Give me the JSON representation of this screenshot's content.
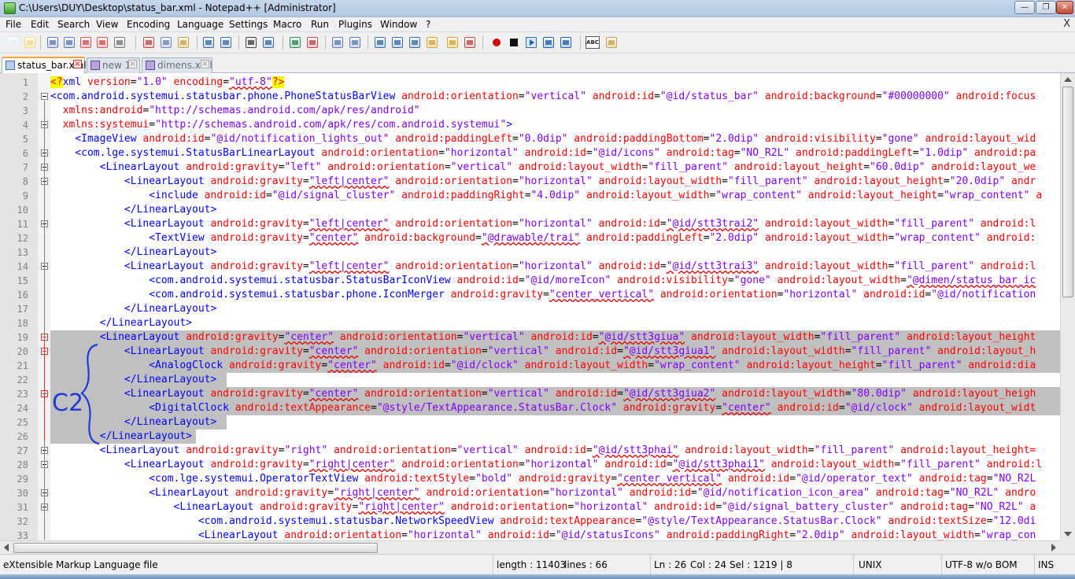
{
  "window": {
    "title": "C:\\Users\\DUY\\Desktop\\status_bar.xml - Notepad++ [Administrator]",
    "minimize": "—",
    "maximize": "❐",
    "close": "✕"
  },
  "menu": [
    "File",
    "Edit",
    "Search",
    "View",
    "Encoding",
    "Language",
    "Settings",
    "Macro",
    "Run",
    "Plugins",
    "Window",
    "?"
  ],
  "menu_close": "X",
  "tabs": [
    {
      "label": "status_bar.xml",
      "active": true
    },
    {
      "label": "new  1",
      "active": false
    },
    {
      "label": "dimens.xml",
      "active": false
    }
  ],
  "toolbar_icons": [
    "new-file-icon",
    "open-file-icon",
    "save-icon",
    "save-all-icon",
    "close-icon",
    "close-all-icon",
    "print-icon",
    "cut-icon",
    "copy-icon",
    "paste-icon",
    "undo-icon",
    "redo-icon",
    "find-icon",
    "replace-icon",
    "zoom-in-icon",
    "zoom-out-icon",
    "sync-v-icon",
    "sync-h-icon",
    "wrap-icon",
    "all-chars-icon",
    "indent-guide-icon",
    "doc-map-icon",
    "folder-icon",
    "func-list-icon",
    "macro-record-icon",
    "macro-stop-icon",
    "macro-play-icon",
    "macro-play-multi-icon",
    "macro-save-icon",
    "spell-check-icon",
    "plugin-icon"
  ],
  "line_numbers": [
    "1",
    "2",
    "3",
    "4",
    "5",
    "6",
    "7",
    "8",
    "9",
    "10",
    "11",
    "12",
    "13",
    "14",
    "15",
    "16",
    "17",
    "18",
    "19",
    "20",
    "21",
    "22",
    "23",
    "24",
    "25",
    "26",
    "27",
    "28",
    "29",
    "30",
    "31",
    "32",
    "33"
  ],
  "code_lines": [
    [
      [
        "q",
        "<?"
      ],
      [
        "t",
        "xml"
      ],
      [
        "a",
        " version"
      ],
      [
        "p",
        "="
      ],
      [
        "v",
        "\"1.0\""
      ],
      [
        "a",
        " encoding"
      ],
      [
        "p",
        "="
      ],
      [
        "v",
        "\"utf-8\""
      ],
      [
        "q",
        "?>"
      ]
    ],
    [
      [
        "t",
        "<com.android.systemui.statusbar.phone.PhoneStatusBarView"
      ],
      [
        "a",
        " android:orientation"
      ],
      [
        "p",
        "="
      ],
      [
        "v",
        "\"vertical\""
      ],
      [
        "a",
        " android:id"
      ],
      [
        "p",
        "="
      ],
      [
        "v",
        "\"@id/status_bar\""
      ],
      [
        "a",
        " android:background"
      ],
      [
        "p",
        "="
      ],
      [
        "v",
        "\"#00000000\""
      ],
      [
        "a",
        " android:focus"
      ]
    ],
    [
      [
        "a",
        "  xmlns:android"
      ],
      [
        "p",
        "="
      ],
      [
        "v",
        "\"http://schemas.android.com/apk/res/android\""
      ]
    ],
    [
      [
        "a",
        "  xmlns:systemui"
      ],
      [
        "p",
        "="
      ],
      [
        "v",
        "\"http://schemas.android.com/apk/res/com.android.systemui\""
      ],
      [
        "t",
        ">"
      ]
    ],
    [
      [
        "t",
        "    <ImageView"
      ],
      [
        "a",
        " android:id"
      ],
      [
        "p",
        "="
      ],
      [
        "v",
        "\"@id/notification_lights_out\""
      ],
      [
        "a",
        " android:paddingLeft"
      ],
      [
        "p",
        "="
      ],
      [
        "v",
        "\"0.0dip\""
      ],
      [
        "a",
        " android:paddingBottom"
      ],
      [
        "p",
        "="
      ],
      [
        "v",
        "\"2.0dip\""
      ],
      [
        "a",
        " android:visibility"
      ],
      [
        "p",
        "="
      ],
      [
        "v",
        "\"gone\""
      ],
      [
        "a",
        " android:layout_wid"
      ]
    ],
    [
      [
        "t",
        "    <com.lge.systemui.StatusBarLinearLayout"
      ],
      [
        "a",
        " android:orientation"
      ],
      [
        "p",
        "="
      ],
      [
        "v",
        "\"horizontal\""
      ],
      [
        "a",
        " android:id"
      ],
      [
        "p",
        "="
      ],
      [
        "v",
        "\"@id/icons\""
      ],
      [
        "a",
        " android:tag"
      ],
      [
        "p",
        "="
      ],
      [
        "v",
        "\"NO_R2L\""
      ],
      [
        "a",
        " android:paddingLeft"
      ],
      [
        "p",
        "="
      ],
      [
        "v",
        "\"1.0dip\""
      ],
      [
        "a",
        " android:pa"
      ]
    ],
    [
      [
        "t",
        "        <LinearLayout"
      ],
      [
        "a",
        " android:gravity"
      ],
      [
        "p",
        "="
      ],
      [
        "v",
        "\"left\""
      ],
      [
        "a",
        " android:orientation"
      ],
      [
        "p",
        "="
      ],
      [
        "v",
        "\"vertical\""
      ],
      [
        "a",
        " android:layout_width"
      ],
      [
        "p",
        "="
      ],
      [
        "v",
        "\"fill_parent\""
      ],
      [
        "a",
        " android:layout_height"
      ],
      [
        "p",
        "="
      ],
      [
        "v",
        "\"60.0dip\""
      ],
      [
        "a",
        " android:layout_we"
      ]
    ],
    [
      [
        "t",
        "            <LinearLayout"
      ],
      [
        "a",
        " android:gravity"
      ],
      [
        "p",
        "="
      ],
      [
        "v",
        "\"left|center\""
      ],
      [
        "a",
        " android:orientation"
      ],
      [
        "p",
        "="
      ],
      [
        "v",
        "\"horizontal\""
      ],
      [
        "a",
        " android:layout_width"
      ],
      [
        "p",
        "="
      ],
      [
        "v",
        "\"fill_parent\""
      ],
      [
        "a",
        " android:layout_height"
      ],
      [
        "p",
        "="
      ],
      [
        "v",
        "\"20.0dip\""
      ],
      [
        "a",
        " andr"
      ]
    ],
    [
      [
        "t",
        "                <include"
      ],
      [
        "a",
        " android:id"
      ],
      [
        "p",
        "="
      ],
      [
        "v",
        "\"@id/signal_cluster\""
      ],
      [
        "a",
        " android:paddingRight"
      ],
      [
        "p",
        "="
      ],
      [
        "v",
        "\"4.0dip\""
      ],
      [
        "a",
        " android:layout_width"
      ],
      [
        "p",
        "="
      ],
      [
        "v",
        "\"wrap_content\""
      ],
      [
        "a",
        " android:layout_height"
      ],
      [
        "p",
        "="
      ],
      [
        "v",
        "\"wrap_content\""
      ],
      [
        "a",
        " a"
      ]
    ],
    [
      [
        "t",
        "            </LinearLayout>"
      ]
    ],
    [
      [
        "t",
        "            <LinearLayout"
      ],
      [
        "a",
        " android:gravity"
      ],
      [
        "p",
        "="
      ],
      [
        "v",
        "\"left|center\""
      ],
      [
        "a",
        " android:orientation"
      ],
      [
        "p",
        "="
      ],
      [
        "v",
        "\"horizontal\""
      ],
      [
        "a",
        " android:id"
      ],
      [
        "p",
        "="
      ],
      [
        "v",
        "\"@id/stt3trai2\""
      ],
      [
        "a",
        " android:layout_width"
      ],
      [
        "p",
        "="
      ],
      [
        "v",
        "\"fill_parent\""
      ],
      [
        "a",
        " android:l"
      ]
    ],
    [
      [
        "t",
        "                <TextView"
      ],
      [
        "a",
        " android:gravity"
      ],
      [
        "p",
        "="
      ],
      [
        "v",
        "\"center\""
      ],
      [
        "a",
        " android:background"
      ],
      [
        "p",
        "="
      ],
      [
        "v",
        "\"@drawable/trai\""
      ],
      [
        "a",
        " android:paddingLeft"
      ],
      [
        "p",
        "="
      ],
      [
        "v",
        "\"2.0dip\""
      ],
      [
        "a",
        " android:layout_width"
      ],
      [
        "p",
        "="
      ],
      [
        "v",
        "\"wrap_content\""
      ],
      [
        "a",
        " android:"
      ]
    ],
    [
      [
        "t",
        "            </LinearLayout>"
      ]
    ],
    [
      [
        "t",
        "            <LinearLayout"
      ],
      [
        "a",
        " android:gravity"
      ],
      [
        "p",
        "="
      ],
      [
        "v",
        "\"left|center\""
      ],
      [
        "a",
        " android:orientation"
      ],
      [
        "p",
        "="
      ],
      [
        "v",
        "\"horizontal\""
      ],
      [
        "a",
        " android:id"
      ],
      [
        "p",
        "="
      ],
      [
        "v",
        "\"@id/stt3trai3\""
      ],
      [
        "a",
        " android:layout_width"
      ],
      [
        "p",
        "="
      ],
      [
        "v",
        "\"fill_parent\""
      ],
      [
        "a",
        " android:l"
      ]
    ],
    [
      [
        "t",
        "                <com.android.systemui.statusbar.StatusBarIconView"
      ],
      [
        "a",
        " android:id"
      ],
      [
        "p",
        "="
      ],
      [
        "v",
        "\"@id/moreIcon\""
      ],
      [
        "a",
        " android:visibility"
      ],
      [
        "p",
        "="
      ],
      [
        "v",
        "\"gone\""
      ],
      [
        "a",
        " android:layout_width"
      ],
      [
        "p",
        "="
      ],
      [
        "v",
        "\"@dimen/status_bar_ic"
      ]
    ],
    [
      [
        "t",
        "                <com.android.systemui.statusbar.phone.IconMerger"
      ],
      [
        "a",
        " android:gravity"
      ],
      [
        "p",
        "="
      ],
      [
        "v",
        "\"center_vertical\""
      ],
      [
        "a",
        " android:orientation"
      ],
      [
        "p",
        "="
      ],
      [
        "v",
        "\"horizontal\""
      ],
      [
        "a",
        " android:id"
      ],
      [
        "p",
        "="
      ],
      [
        "v",
        "\"@id/notification"
      ]
    ],
    [
      [
        "t",
        "            </LinearLayout>"
      ]
    ],
    [
      [
        "t",
        "        </LinearLayout>"
      ]
    ],
    [
      [
        "t",
        "        <LinearLayout"
      ],
      [
        "a",
        " android:gravity"
      ],
      [
        "p",
        "="
      ],
      [
        "v",
        "\"center\""
      ],
      [
        "a",
        " android:orientation"
      ],
      [
        "p",
        "="
      ],
      [
        "v",
        "\"vertical\""
      ],
      [
        "a",
        " android:id"
      ],
      [
        "p",
        "="
      ],
      [
        "v",
        "\"@id/stt3giua\""
      ],
      [
        "a",
        " android:layout_width"
      ],
      [
        "p",
        "="
      ],
      [
        "v",
        "\"fill_parent\""
      ],
      [
        "a",
        " android:layout_height"
      ]
    ],
    [
      [
        "t",
        "            <LinearLayout"
      ],
      [
        "a",
        " android:gravity"
      ],
      [
        "p",
        "="
      ],
      [
        "v",
        "\"center\""
      ],
      [
        "a",
        " android:orientation"
      ],
      [
        "p",
        "="
      ],
      [
        "v",
        "\"vertical\""
      ],
      [
        "a",
        " android:id"
      ],
      [
        "p",
        "="
      ],
      [
        "v",
        "\"@id/stt3giua1\""
      ],
      [
        "a",
        " android:layout_width"
      ],
      [
        "p",
        "="
      ],
      [
        "v",
        "\"fill_parent\""
      ],
      [
        "a",
        " android:layout_h"
      ]
    ],
    [
      [
        "t",
        "                <AnalogClock"
      ],
      [
        "a",
        " android:gravity"
      ],
      [
        "p",
        "="
      ],
      [
        "v",
        "\"center\""
      ],
      [
        "a",
        " android:id"
      ],
      [
        "p",
        "="
      ],
      [
        "v",
        "\"@id/clock\""
      ],
      [
        "a",
        " android:layout_width"
      ],
      [
        "p",
        "="
      ],
      [
        "v",
        "\"wrap_content\""
      ],
      [
        "a",
        " android:layout_height"
      ],
      [
        "p",
        "="
      ],
      [
        "v",
        "\"fill_parent\""
      ],
      [
        "a",
        " android:dia"
      ]
    ],
    [
      [
        "t",
        "            </LinearLayout>"
      ]
    ],
    [
      [
        "t",
        "            <LinearLayout"
      ],
      [
        "a",
        " android:gravity"
      ],
      [
        "p",
        "="
      ],
      [
        "v",
        "\"center\""
      ],
      [
        "a",
        " android:orientation"
      ],
      [
        "p",
        "="
      ],
      [
        "v",
        "\"vertical\""
      ],
      [
        "a",
        " android:id"
      ],
      [
        "p",
        "="
      ],
      [
        "v",
        "\"@id/stt3giua2\""
      ],
      [
        "a",
        " android:layout_width"
      ],
      [
        "p",
        "="
      ],
      [
        "v",
        "\"80.0dip\""
      ],
      [
        "a",
        " android:layout_heigh"
      ]
    ],
    [
      [
        "t",
        "                <DigitalClock"
      ],
      [
        "a",
        " android:textAppearance"
      ],
      [
        "p",
        "="
      ],
      [
        "v",
        "\"@style/TextAppearance.StatusBar.Clock\""
      ],
      [
        "a",
        " android:gravity"
      ],
      [
        "p",
        "="
      ],
      [
        "v",
        "\"center\""
      ],
      [
        "a",
        " android:id"
      ],
      [
        "p",
        "="
      ],
      [
        "v",
        "\"@id/clock\""
      ],
      [
        "a",
        " android:layout_widt"
      ]
    ],
    [
      [
        "t",
        "            </LinearLayout>"
      ]
    ],
    [
      [
        "t",
        "        </LinearLayout>"
      ]
    ],
    [
      [
        "t",
        "        <LinearLayout"
      ],
      [
        "a",
        " android:gravity"
      ],
      [
        "p",
        "="
      ],
      [
        "v",
        "\"right\""
      ],
      [
        "a",
        " android:orientation"
      ],
      [
        "p",
        "="
      ],
      [
        "v",
        "\"vertical\""
      ],
      [
        "a",
        " android:id"
      ],
      [
        "p",
        "="
      ],
      [
        "v",
        "\"@id/stt3phai\""
      ],
      [
        "a",
        " android:layout_width"
      ],
      [
        "p",
        "="
      ],
      [
        "v",
        "\"fill_parent\""
      ],
      [
        "a",
        " android:layout_height="
      ]
    ],
    [
      [
        "t",
        "            <LinearLayout"
      ],
      [
        "a",
        " android:gravity"
      ],
      [
        "p",
        "="
      ],
      [
        "v",
        "\"right|center\""
      ],
      [
        "a",
        " android:orientation"
      ],
      [
        "p",
        "="
      ],
      [
        "v",
        "\"horizontal\""
      ],
      [
        "a",
        " android:id"
      ],
      [
        "p",
        "="
      ],
      [
        "v",
        "\"@id/stt3phai1\""
      ],
      [
        "a",
        " android:layout_width"
      ],
      [
        "p",
        "="
      ],
      [
        "v",
        "\"fill_parent\""
      ],
      [
        "a",
        " android:l"
      ]
    ],
    [
      [
        "t",
        "                <com.lge.systemui.OperatorTextView"
      ],
      [
        "a",
        " android:textStyle"
      ],
      [
        "p",
        "="
      ],
      [
        "v",
        "\"bold\""
      ],
      [
        "a",
        " android:gravity"
      ],
      [
        "p",
        "="
      ],
      [
        "v",
        "\"center_vertical\""
      ],
      [
        "a",
        " android:id"
      ],
      [
        "p",
        "="
      ],
      [
        "v",
        "\"@id/operator_text\""
      ],
      [
        "a",
        " android:tag"
      ],
      [
        "p",
        "="
      ],
      [
        "v",
        "\"NO_R2L"
      ]
    ],
    [
      [
        "t",
        "                <LinearLayout"
      ],
      [
        "a",
        " android:gravity"
      ],
      [
        "p",
        "="
      ],
      [
        "v",
        "\"right|center\""
      ],
      [
        "a",
        " android:orientation"
      ],
      [
        "p",
        "="
      ],
      [
        "v",
        "\"horizontal\""
      ],
      [
        "a",
        " android:id"
      ],
      [
        "p",
        "="
      ],
      [
        "v",
        "\"@id/notification_icon_area\""
      ],
      [
        "a",
        " android:tag"
      ],
      [
        "p",
        "="
      ],
      [
        "v",
        "\"NO_R2L\""
      ],
      [
        "a",
        " andro"
      ]
    ],
    [
      [
        "t",
        "                    <LinearLayout"
      ],
      [
        "a",
        " android:gravity"
      ],
      [
        "p",
        "="
      ],
      [
        "v",
        "\"right|center\""
      ],
      [
        "a",
        " android:orientation"
      ],
      [
        "p",
        "="
      ],
      [
        "v",
        "\"horizontal\""
      ],
      [
        "a",
        " android:id"
      ],
      [
        "p",
        "="
      ],
      [
        "v",
        "\"@id/signal_battery_cluster\""
      ],
      [
        "a",
        " android:tag"
      ],
      [
        "p",
        "="
      ],
      [
        "v",
        "\"NO_R2L\""
      ],
      [
        "a",
        " a"
      ]
    ],
    [
      [
        "t",
        "                        <com.android.systemui.statusbar.NetworkSpeedView"
      ],
      [
        "a",
        " android:textAppearance"
      ],
      [
        "p",
        "="
      ],
      [
        "v",
        "\"@style/TextAppearance.StatusBar.Clock\""
      ],
      [
        "a",
        " android:textSize"
      ],
      [
        "p",
        "="
      ],
      [
        "v",
        "\"12.0di"
      ]
    ],
    [
      [
        "t",
        "                        <LinearLayout"
      ],
      [
        "a",
        " android:orientation"
      ],
      [
        "p",
        "="
      ],
      [
        "v",
        "\"horizontal\""
      ],
      [
        "a",
        " android:id"
      ],
      [
        "p",
        "="
      ],
      [
        "v",
        "\"@id/statusIcons\""
      ],
      [
        "a",
        " android:paddingRight"
      ],
      [
        "p",
        "="
      ],
      [
        "v",
        "\"2.0dip\""
      ],
      [
        "a",
        " android:layout_width"
      ],
      [
        "p",
        "="
      ],
      [
        "v",
        "\"wrap_con"
      ]
    ]
  ],
  "annotation_text": "C2",
  "status": {
    "language": "eXtensible Markup Language file",
    "length": "length : 11403",
    "lines": "lines : 66",
    "ln": "Ln : 26",
    "col": "Col : 24",
    "sel": "Sel : 1219 | 8",
    "eol": "UNIX",
    "encoding": "UTF-8 w/o BOM",
    "mode": "INS"
  },
  "colors": {
    "tag": "#0000ff",
    "attribute": "#ff0000",
    "value": "#8000ff",
    "selection": "#c0c0c0",
    "annotation": "#1f3ad6"
  }
}
